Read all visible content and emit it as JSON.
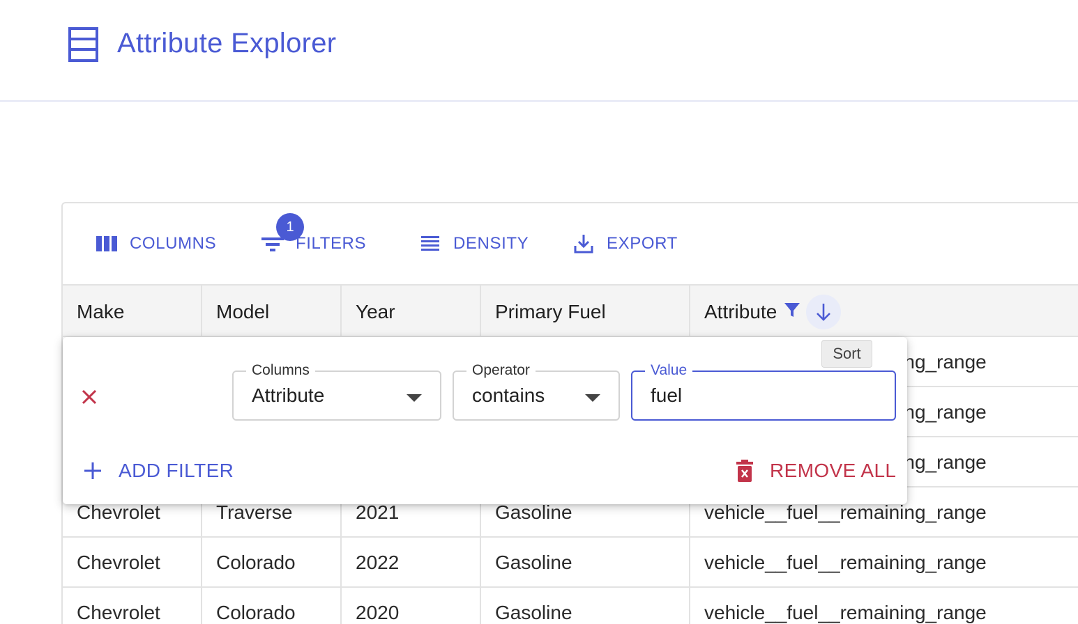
{
  "app": {
    "title": "Attribute Explorer",
    "accent_color": "#4a5ad4",
    "danger_color": "#c2344a"
  },
  "toolbar": {
    "columns_label": "COLUMNS",
    "filters_label": "FILTERS",
    "filters_badge": "1",
    "density_label": "DENSITY",
    "export_label": "EXPORT"
  },
  "table": {
    "columns": [
      "Make",
      "Model",
      "Year",
      "Primary Fuel",
      "Attribute"
    ],
    "rows": [
      {
        "make": "",
        "model": "",
        "year": "",
        "fuel": "",
        "attribute": "vehicle__fuel__remaining_range"
      },
      {
        "make": "",
        "model": "",
        "year": "",
        "fuel": "",
        "attribute": "vehicle__fuel__remaining_range"
      },
      {
        "make": "",
        "model": "",
        "year": "",
        "fuel": "",
        "attribute": "vehicle__fuel__remaining_range"
      },
      {
        "make": "Chevrolet",
        "model": "Traverse",
        "year": "2021",
        "fuel": "Gasoline",
        "attribute": "vehicle__fuel__remaining_range"
      },
      {
        "make": "Chevrolet",
        "model": "Colorado",
        "year": "2022",
        "fuel": "Gasoline",
        "attribute": "vehicle__fuel__remaining_range"
      },
      {
        "make": "Chevrolet",
        "model": "Colorado",
        "year": "2020",
        "fuel": "Gasoline",
        "attribute": "vehicle__fuel__remaining_range"
      }
    ]
  },
  "tooltip": {
    "sort": "Sort"
  },
  "filter_panel": {
    "columns_label": "Columns",
    "columns_value": "Attribute",
    "operator_label": "Operator",
    "operator_value": "contains",
    "value_label": "Value",
    "value_value": "fuel",
    "add_filter_label": "ADD FILTER",
    "remove_all_label": "REMOVE ALL"
  }
}
